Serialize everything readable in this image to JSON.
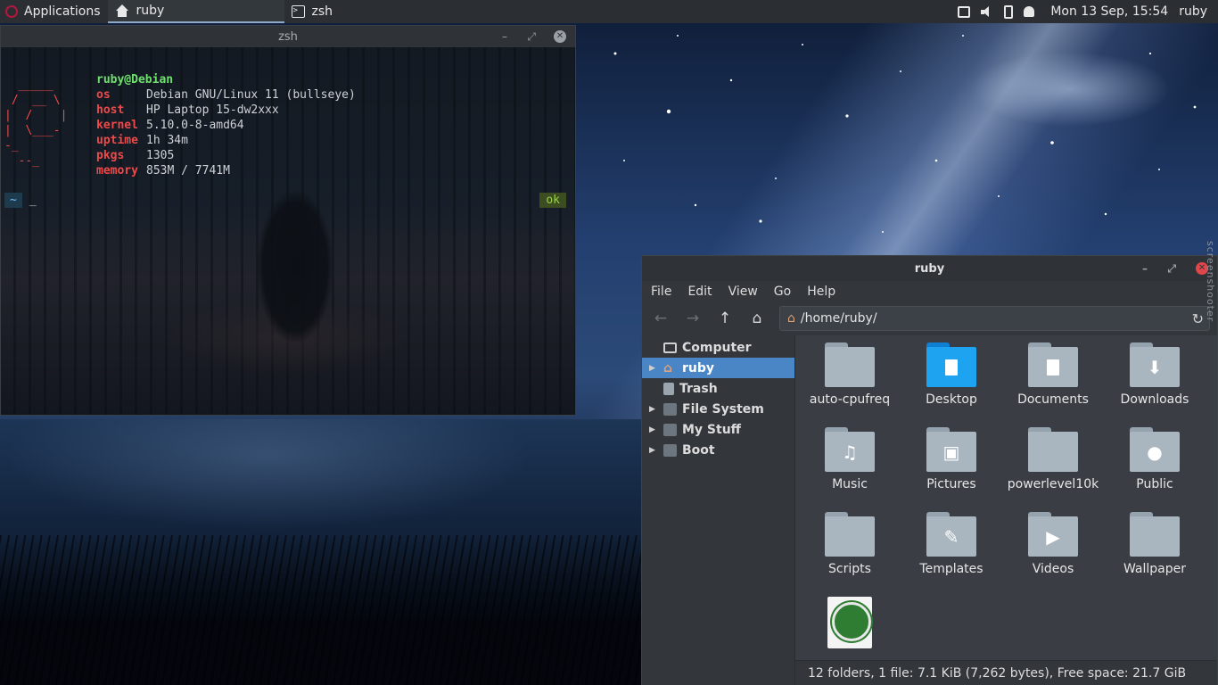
{
  "panel": {
    "applications_label": "Applications",
    "tasks": [
      {
        "label": "ruby",
        "icon": "home-icon",
        "active": true
      },
      {
        "label": "zsh",
        "icon": "terminal-icon",
        "active": false
      }
    ],
    "clock": "Mon 13 Sep, 15:54",
    "user": "ruby"
  },
  "terminal": {
    "title": "zsh",
    "userhost": "ruby@Debian",
    "info": [
      {
        "key": "os",
        "value": "Debian GNU/Linux 11 (bullseye)"
      },
      {
        "key": "host",
        "value": "HP Laptop 15-dw2xxx"
      },
      {
        "key": "kernel",
        "value": "5.10.0-8-amd64"
      },
      {
        "key": "uptime",
        "value": "1h 34m"
      },
      {
        "key": "pkgs",
        "value": "1305"
      },
      {
        "key": "memory",
        "value": "853M / 7741M"
      }
    ],
    "prompt_dir": "~",
    "cursor": "_",
    "status": "ok"
  },
  "filemanager": {
    "title": "ruby",
    "menu": [
      "File",
      "Edit",
      "View",
      "Go",
      "Help"
    ],
    "location": "/home/ruby/",
    "sidebar": [
      {
        "label": "Computer",
        "expandable": false,
        "selected": false,
        "icon": "computer-icon"
      },
      {
        "label": "ruby",
        "expandable": true,
        "selected": true,
        "icon": "home-icon"
      },
      {
        "label": "Trash",
        "expandable": false,
        "selected": false,
        "icon": "trash-icon"
      },
      {
        "label": "File System",
        "expandable": true,
        "selected": false,
        "icon": "drive-icon"
      },
      {
        "label": "My Stuff",
        "expandable": true,
        "selected": false,
        "icon": "drive-icon"
      },
      {
        "label": "Boot",
        "expandable": true,
        "selected": false,
        "icon": "drive-icon"
      }
    ],
    "items": [
      {
        "label": "auto-cpufreq",
        "icon": "folder-icon"
      },
      {
        "label": "Desktop",
        "icon": "desktop-folder-icon"
      },
      {
        "label": "Documents",
        "icon": "documents-folder-icon"
      },
      {
        "label": "Downloads",
        "icon": "downloads-folder-icon"
      },
      {
        "label": "Music",
        "icon": "music-folder-icon"
      },
      {
        "label": "Pictures",
        "icon": "pictures-folder-icon"
      },
      {
        "label": "powerlevel10k",
        "icon": "folder-icon"
      },
      {
        "label": "Public",
        "icon": "public-folder-icon"
      },
      {
        "label": "Scripts",
        "icon": "folder-icon"
      },
      {
        "label": "Templates",
        "icon": "templates-folder-icon"
      },
      {
        "label": "Videos",
        "icon": "videos-folder-icon"
      },
      {
        "label": "Wallpaper",
        "icon": "folder-icon"
      },
      {
        "label": "",
        "icon": "keepass-file-icon"
      }
    ],
    "statusbar": "12 folders, 1 file: 7.1 KiB (7,262 bytes), Free space: 21.7 GiB"
  },
  "desktop": {
    "side_text": "screenshooter"
  }
}
